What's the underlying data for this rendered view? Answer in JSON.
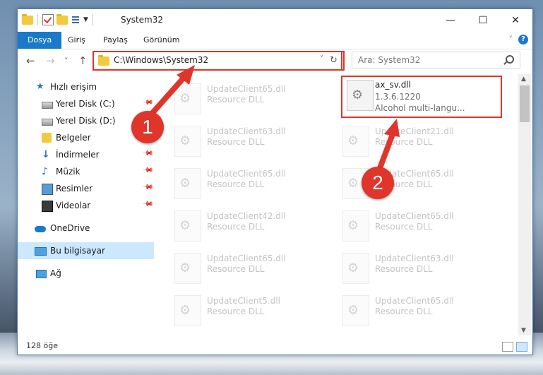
{
  "window": {
    "title": "System32"
  },
  "ribbon": {
    "tabs": [
      "Dosya",
      "Giriş",
      "Paylaş",
      "Görünüm"
    ],
    "expand_icon": "chevron-down-icon",
    "help": "?"
  },
  "nav": {
    "back": "←",
    "forward": "→",
    "recent": "˅",
    "up": "↑"
  },
  "address": {
    "path": "C:\\Windows\\System32",
    "dropdown": "˅",
    "refresh": "↻"
  },
  "search": {
    "placeholder": "Ara: System32"
  },
  "sidebar": {
    "items": [
      {
        "label": "Hızlı erişim",
        "icon": "star-icon"
      },
      {
        "label": "Yerel Disk (C:)",
        "icon": "disk-icon",
        "pinned": true
      },
      {
        "label": "Yerel Disk (D:)",
        "icon": "disk-icon"
      },
      {
        "label": "Belgeler",
        "icon": "documents-icon",
        "pinned": true
      },
      {
        "label": "İndirmeler",
        "icon": "download-icon",
        "pinned": true
      },
      {
        "label": "Müzik",
        "icon": "music-icon",
        "pinned": true
      },
      {
        "label": "Resimler",
        "icon": "pictures-icon",
        "pinned": true
      },
      {
        "label": "Videolar",
        "icon": "video-icon",
        "pinned": true
      },
      {
        "label": "OneDrive",
        "icon": "cloud-icon"
      },
      {
        "label": "Bu bilgisayar",
        "icon": "computer-icon",
        "selected": true
      },
      {
        "label": "Ağ",
        "icon": "network-icon"
      }
    ]
  },
  "files": {
    "left": [
      {
        "name": "UpdateClient65.dll",
        "type": "Resource DLL"
      },
      {
        "name": "UpdateClient63.dll",
        "type": "Resource DLL"
      },
      {
        "name": "UpdateClient65.dll",
        "type": "Resource DLL"
      },
      {
        "name": "UpdateClient42.dll",
        "type": "Resource DLL"
      },
      {
        "name": "UpdateClient65.dll",
        "type": "Resource DLL"
      },
      {
        "name": "UpdateClient5.dll",
        "type": "Resource DLL"
      }
    ],
    "right_top": {
      "name": "ax_sv.dll",
      "version": "1.3.6.1220",
      "description": "Alcohol multi-langu..."
    },
    "right": [
      {
        "name": "UpdateClient21.dll",
        "type": "Resource DLL"
      },
      {
        "name": "UpdateClient65.dll",
        "type": "Resource DLL"
      },
      {
        "name": "UpdateClient65.dll",
        "type": "Resource DLL"
      },
      {
        "name": "UpdateClient63.dll",
        "type": "Resource DLL"
      },
      {
        "name": "UpdateClient65.dll",
        "type": "Resource DLL"
      }
    ]
  },
  "status": {
    "count": "128 öğe"
  },
  "annotations": {
    "badge1": "1",
    "badge2": "2",
    "color": "#e0352b"
  }
}
